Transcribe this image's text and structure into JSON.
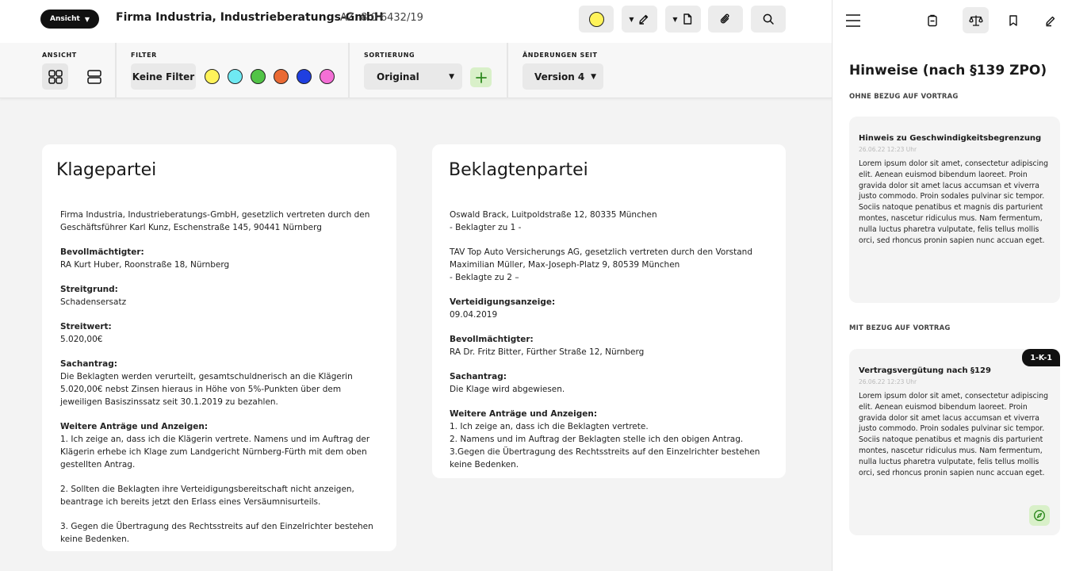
{
  "header": {
    "view_label": "Ansicht",
    "case_title": "Firma Industria, Industrieberatungs-GmbH",
    "case_az": "AZ. 8 0 6432/19"
  },
  "filterbar": {
    "ansicht_label": "ANSICHT",
    "filter_label": "FILTER",
    "filter_none": "Keine Filter",
    "filter_colors": [
      "#fff35a",
      "#6fe9f2",
      "#52c447",
      "#ea6a34",
      "#1f3fe0",
      "#f46fd6"
    ],
    "sort_label": "SORTIERUNG",
    "sort_value": "Original",
    "changes_label": "ÄNDERUNGEN SEIT",
    "changes_value": "Version 4"
  },
  "toolbar": {
    "highlight_color": "#fff35a"
  },
  "klage": {
    "title": "Klagepartei",
    "party": "Firma Industria, Industrieberatungs-GmbH, gesetzlich vertreten durch den Geschäftsführer Karl Kunz, Eschenstraße 145, 90441 Nürnberg",
    "bevoll_label": "Bevollmächtigter:",
    "bevoll_value": "RA Kurt Huber, Roonstraße 18, Nürnberg",
    "grund_label": "Streitgrund:",
    "grund_value": "Schadensersatz",
    "wert_label": "Streitwert:",
    "wert_value": "5.020,00€",
    "antrag_label": "Sachantrag:",
    "antrag_value": "Die Beklagten werden verurteilt, gesamtschuldnerisch an die Klägerin 5.020,00€ nebst Zinsen hieraus in Höhe von 5%-Punkten über dem jeweiligen Basiszinssatz seit 30.1.2019 zu bezahlen.",
    "weitere_label": "Weitere Anträge und Anzeigen:",
    "weitere_1": "1. Ich zeige an, dass ich die Klägerin vertrete. Namens und im Auftrag der Klägerin erhebe ich Klage zum Landgericht Nürnberg-Fürth mit dem oben gestellten Antrag.",
    "weitere_2": "2. Sollten die Beklagten ihre Verteidigungsbereitschaft nicht anzeigen, beantrage ich bereits jetzt den Erlass eines Versäumnisurteils.",
    "weitere_3": "3. Gegen die Übertragung des Rechtsstreits auf den Einzelrichter bestehen keine Bedenken."
  },
  "beklagte": {
    "title": "Beklagtenpartei",
    "party_1": "Oswald Brack, Luitpoldstraße 12, 80335 München\n- Beklagter zu 1 -",
    "party_2": "TAV Top Auto Versicherungs AG, gesetzlich vertreten durch den Vorstand Maximilian Müller, Max-Joseph-Platz 9, 80539 München\n- Beklagte zu 2 –",
    "vert_label": "Verteidigungsanzeige:",
    "vert_value": "09.04.2019",
    "bevoll_label": "Bevollmächtigter:",
    "bevoll_value": "RA Dr. Fritz Bitter, Fürther Straße 12, Nürnberg",
    "antrag_label": "Sachantrag:",
    "antrag_value": "Die Klage wird abgewiesen.",
    "weitere_label": "Weitere Anträge und Anzeigen:",
    "weitere_value": "1. Ich zeige an, dass ich die Beklagten vertrete.\n2. Namens und im Auftrag der Beklagten stelle ich den obigen Antrag.\n3.Gegen die Übertragung des Rechtsstreits auf den Einzelrichter bestehen keine Bedenken."
  },
  "panel": {
    "title": "Hinweise (nach §139 ZPO)",
    "sub_ohne": "OHNE BEZUG AUF VORTRAG",
    "sub_mit": "MIT BEZUG AUF VORTRAG",
    "notes": [
      {
        "title": "Hinweis zu Geschwindigkeitsbegrenzung",
        "date": "26.06.22 12:23 Uhr",
        "body": "Lorem ipsum dolor sit amet, consectetur adipiscing elit. Aenean euismod bibendum laoreet. Proin gravida dolor sit amet lacus accumsan et viverra justo commodo. Proin sodales pulvinar sic tempor. Sociis natoque penatibus et magnis dis parturient montes, nascetur ridiculus mus. Nam fermentum, nulla luctus pharetra vulputate, felis tellus mollis orci, sed rhoncus pronin sapien nunc accuan eget."
      },
      {
        "badge": "1-K-1",
        "title": "Vertragsvergütung nach §129",
        "date": "26.06.22 12:23 Uhr",
        "body": "Lorem ipsum dolor sit amet, consectetur adipiscing elit. Aenean euismod bibendum laoreet. Proin gravida dolor sit amet lacus accumsan et viverra justo commodo. Proin sodales pulvinar sic tempor. Sociis natoque penatibus et magnis dis parturient montes, nascetur ridiculus mus. Nam fermentum, nulla luctus pharetra vulputate, felis tellus mollis orci, sed rhoncus pronin sapien nunc accuan eget."
      }
    ]
  }
}
